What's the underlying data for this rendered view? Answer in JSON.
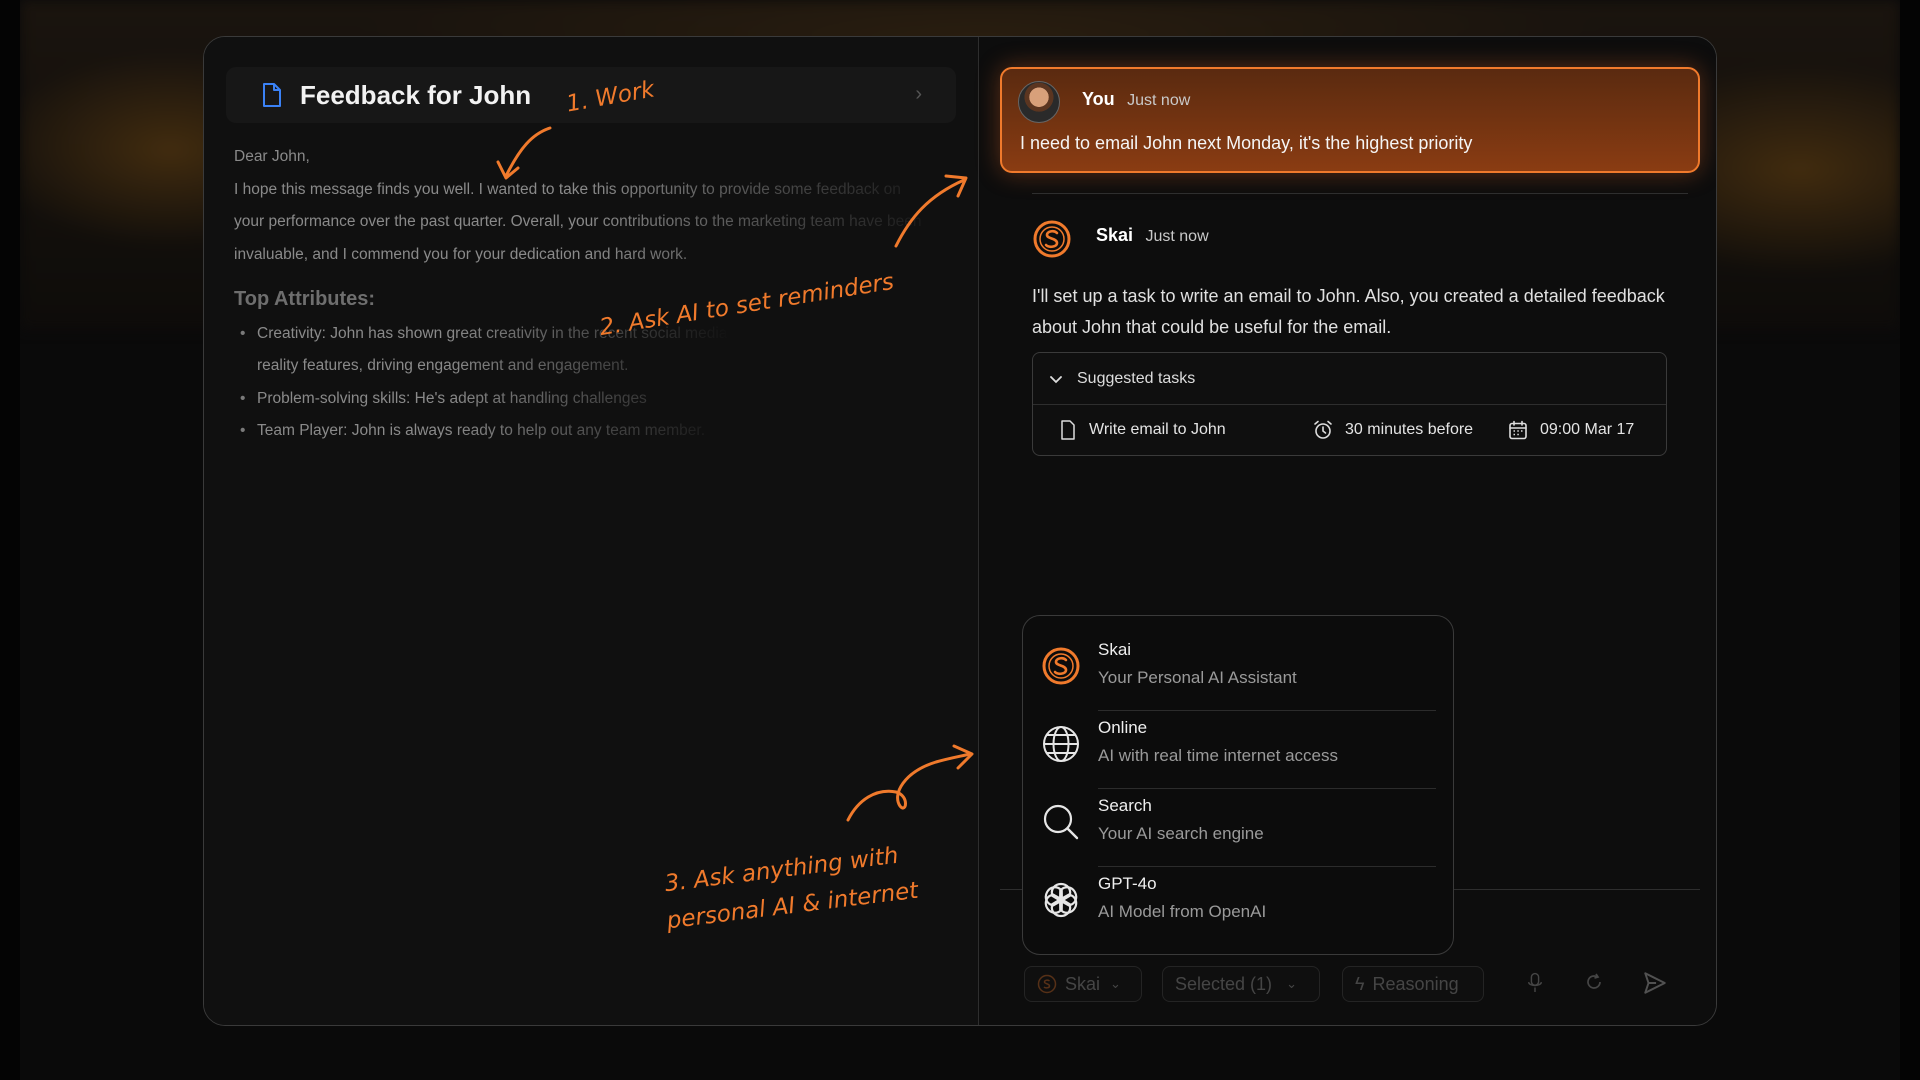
{
  "document": {
    "title": "Feedback for John",
    "greeting": "Dear John,",
    "paragraph": "I hope this message finds you well. I wanted to take this opportunity to provide some feedback on your performance over the past quarter. Overall, your contributions to the marketing team have been invaluable, and I commend you for your dedication and hard work.",
    "section_title": "Top Attributes:",
    "bullets": [
      "Creativity: John has shown great creativity in the recent social media campaign using augmented reality features, driving engagement and engagement.",
      "Problem-solving skills: He's adept at handling challenges",
      "Team Player: John is always ready to help out any team member."
    ]
  },
  "chat": {
    "user_message": {
      "name": "You",
      "time": "Just now",
      "text": "I need to email John next Monday, it's the highest priority"
    },
    "ai_message": {
      "name": "Skai",
      "time": "Just now",
      "text": "I'll set up a task to write an email to John. Also, you created a detailed feedback about John that could be useful for the email."
    },
    "suggested_tasks": {
      "header": "Suggested tasks",
      "task": {
        "name": "Write email to John",
        "reminder": "30 minutes before",
        "due": "09:00 Mar 17"
      }
    }
  },
  "model_menu": {
    "items": [
      {
        "title": "Skai",
        "subtitle": "Your Personal AI Assistant",
        "icon": "skai-logo-icon"
      },
      {
        "title": "Online",
        "subtitle": "AI with real time internet access",
        "icon": "globe-icon"
      },
      {
        "title": "Search",
        "subtitle": "Your AI search engine",
        "icon": "search-icon"
      },
      {
        "title": "GPT-4o",
        "subtitle": "AI Model from OpenAI",
        "icon": "openai-icon"
      }
    ]
  },
  "toolbar": {
    "model_label": "Skai",
    "selected_label": "Selected (1)",
    "reasoning_label": "Reasoning"
  },
  "annotations": {
    "a1": "1. Work",
    "a2": "2. Ask AI to set reminders",
    "a3_line1": "3. Ask anything with",
    "a3_line2": "personal AI & internet"
  },
  "colors": {
    "accent": "#f07a2c",
    "background": "#0c0c0c",
    "doc_icon": "#3b82f6"
  }
}
